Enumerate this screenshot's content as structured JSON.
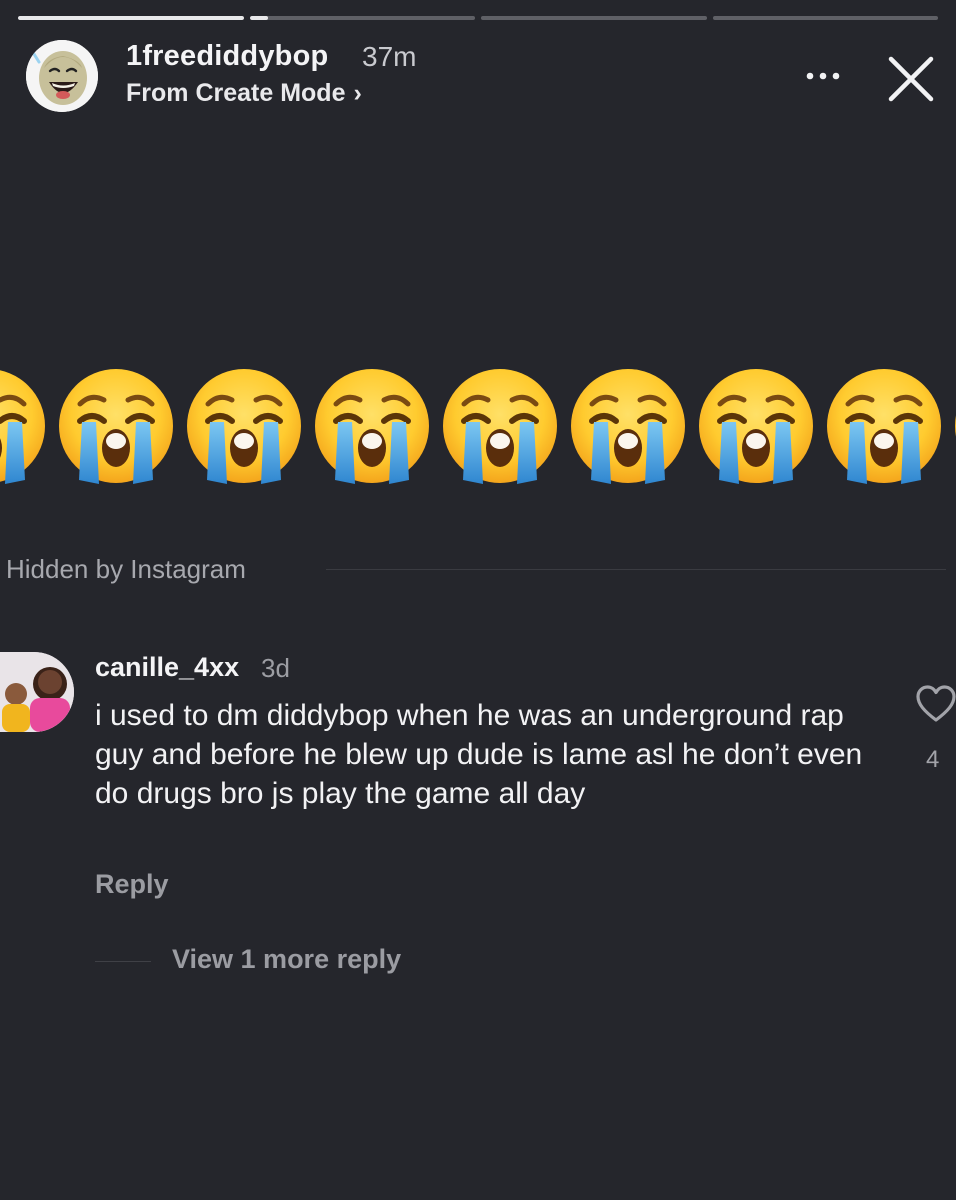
{
  "story": {
    "progress": [
      {
        "segment": 1,
        "fill": 1.0
      },
      {
        "segment": 2,
        "fill": 0.08
      },
      {
        "segment": 3,
        "fill": 0.0
      },
      {
        "segment": 4,
        "fill": 0.0
      }
    ],
    "header": {
      "username": "1freediddybop",
      "timestamp": "37m",
      "subtitle": "From Create Mode",
      "subtitle_chevron": "›",
      "more_icon": "more-horizontal-icon",
      "close_icon": "close-icon"
    },
    "emoji_row": {
      "emoji": "loudly-crying-face",
      "visible_count": 9
    }
  },
  "comments": {
    "hidden_label": "Hidden by Instagram",
    "comment": {
      "username": "canille_4xx",
      "time": "3d",
      "text": "i used to dm diddybop when he was an underground rap guy and before he blew up dude is lame asl he don’t even do drugs bro js play the game all day",
      "like_count": "4",
      "reply_label": "Reply",
      "view_replies_label": "View 1 more reply",
      "like_icon": "heart-outline-icon"
    }
  },
  "colors": {
    "background": "#25262c",
    "progress_track": "#5f6066",
    "progress_fill": "#e8e8ea",
    "emoji_yellow": "#ffcb2f",
    "tear_blue": "#4aa3df"
  }
}
